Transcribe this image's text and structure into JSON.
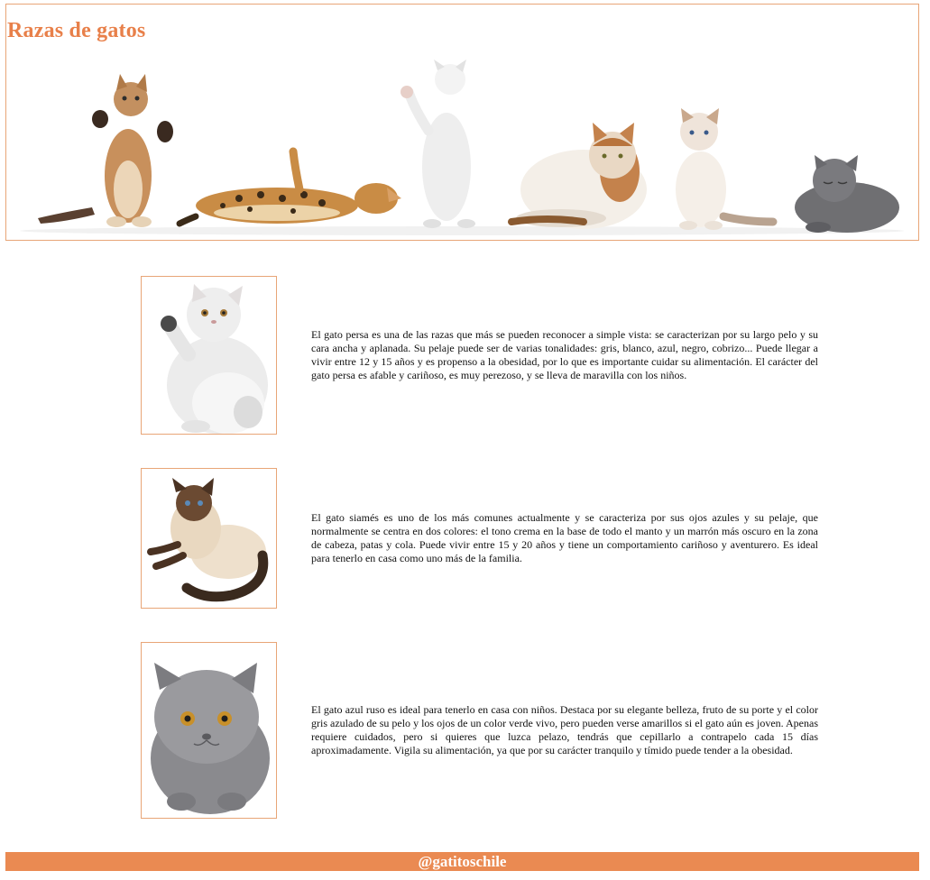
{
  "header": {
    "title": "Razas de gatos",
    "banner_icon": "cats-banner-image"
  },
  "breeds": [
    {
      "name": "persa",
      "image_icon": "persian-cat-image",
      "text": "El gato persa es una de las razas que más se pueden reconocer a simple vista: se caracterizan por su largo pelo y su cara ancha y aplanada. Su pelaje puede ser de varias tonalidades: gris, blanco, azul, negro, cobrizo... Puede llegar a vivir entre 12 y 15 años y es propenso a la obesidad, por lo que es importante cuidar su alimentación. El carácter del gato persa es afable y cariñoso, es muy perezoso, y se lleva de maravilla con los niños."
    },
    {
      "name": "siames",
      "image_icon": "siamese-cat-image",
      "text": "El gato siamés es uno de los más comunes actualmente y se caracteriza por sus ojos azules y su pelaje, que normalmente se centra en dos colores: el tono crema en la base de todo el manto y un marrón más oscuro en la zona de cabeza, patas y cola. Puede vivir entre 15 y 20 años y tiene un comportamiento cariñoso y aventurero. Es ideal para tenerlo en casa como uno más de la familia."
    },
    {
      "name": "azul ruso",
      "image_icon": "russian-blue-cat-image",
      "text": "El gato azul ruso es ideal para tenerlo en casa con niños. Destaca por su elegante belleza, fruto de su porte y el color gris azulado de su pelo y los ojos de un color verde vivo, pero pueden verse amarillos si el gato aún es joven. Apenas requiere cuidados, pero si quieres que luzca pelazo, tendrás que cepillarlo a contrapelo cada 15 días aproximadamente. Vigila su alimentación, ya que por su carácter tranquilo y tímido puede tender a la obesidad."
    }
  ],
  "footer": {
    "handle": "@gatitoschile"
  },
  "colors": {
    "accent": "#e8804a",
    "border": "#e8a577",
    "footer_bg": "#ea8a52"
  }
}
